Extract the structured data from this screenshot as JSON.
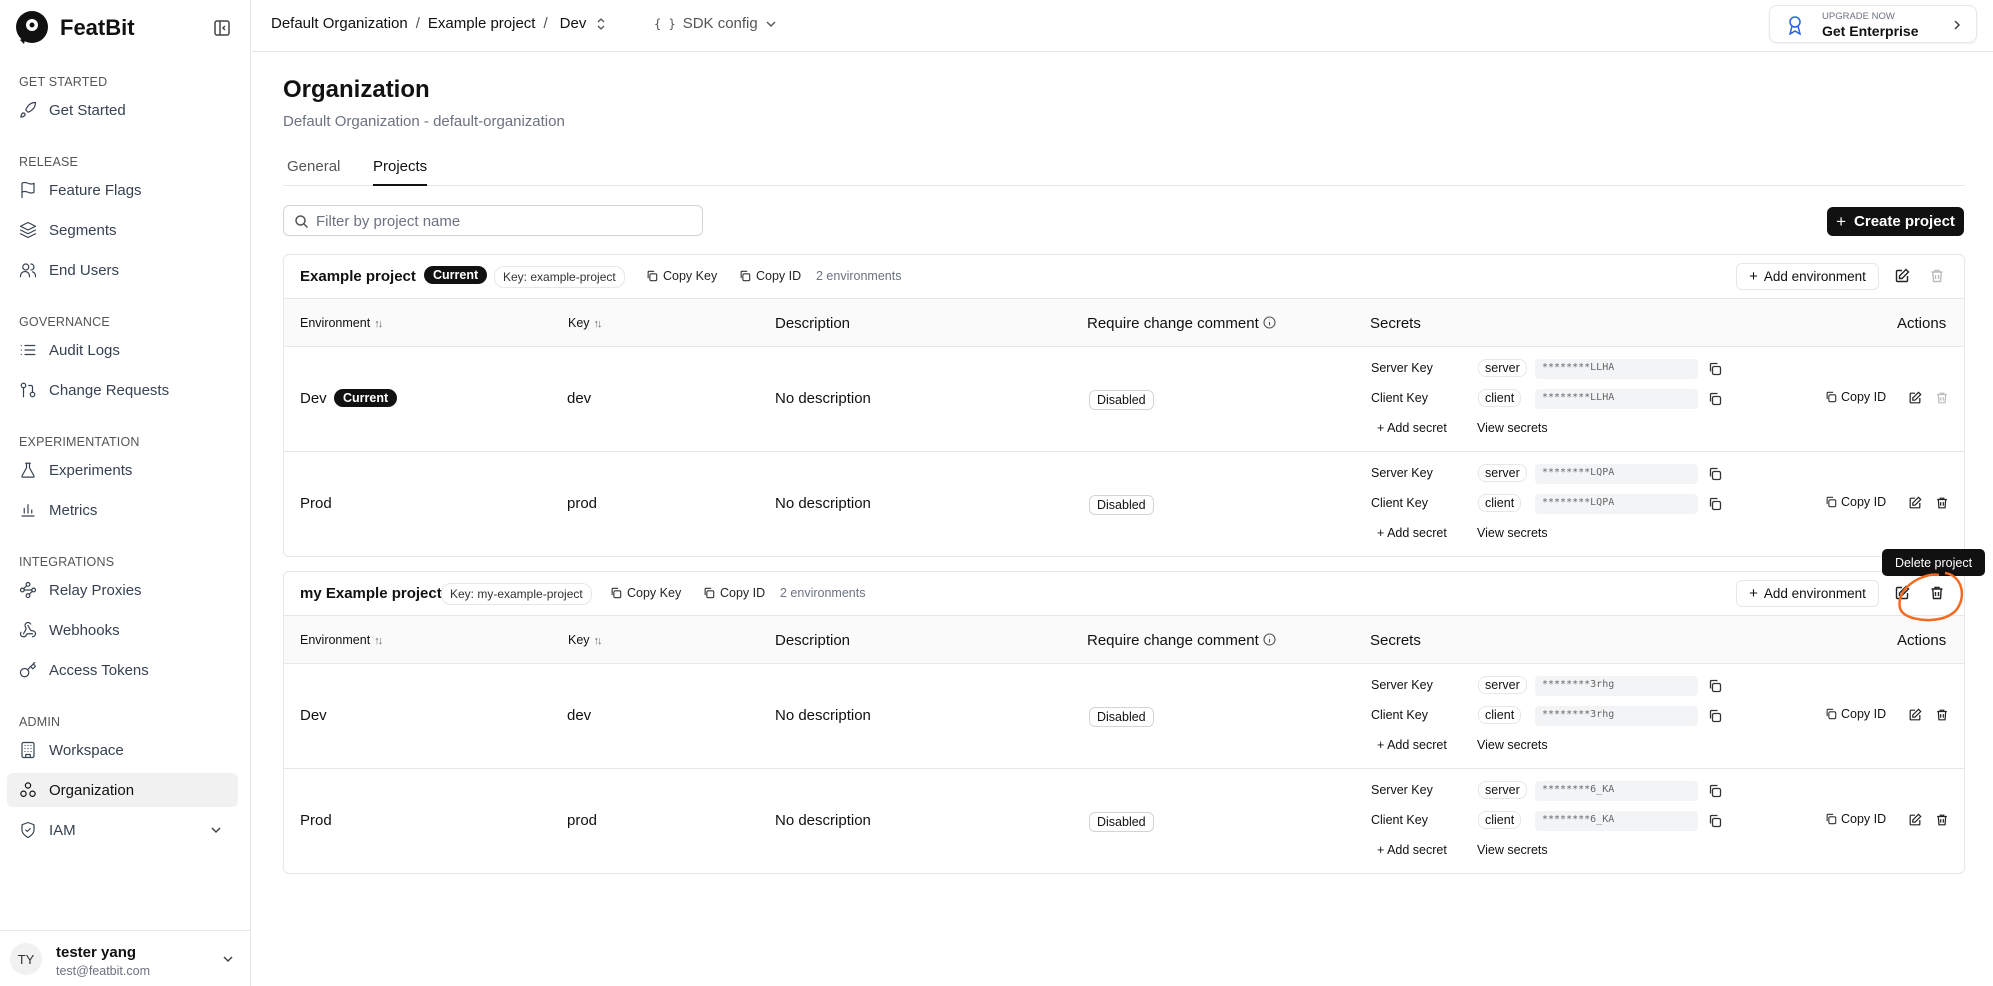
{
  "brand": {
    "name": "FeatBit"
  },
  "sidebar": {
    "sections": [
      {
        "title": "GET STARTED",
        "items": [
          {
            "label": "Get Started",
            "icon": "rocket-icon"
          }
        ]
      },
      {
        "title": "RELEASE",
        "items": [
          {
            "label": "Feature Flags",
            "icon": "flag-icon"
          },
          {
            "label": "Segments",
            "icon": "layers-icon"
          },
          {
            "label": "End Users",
            "icon": "users-icon"
          }
        ]
      },
      {
        "title": "GOVERNANCE",
        "items": [
          {
            "label": "Audit Logs",
            "icon": "list-icon"
          },
          {
            "label": "Change Requests",
            "icon": "git-pull-request-icon"
          }
        ]
      },
      {
        "title": "EXPERIMENTATION",
        "items": [
          {
            "label": "Experiments",
            "icon": "flask-icon"
          },
          {
            "label": "Metrics",
            "icon": "bar-chart-icon"
          }
        ]
      },
      {
        "title": "INTEGRATIONS",
        "items": [
          {
            "label": "Relay Proxies",
            "icon": "waypoints-icon"
          },
          {
            "label": "Webhooks",
            "icon": "webhook-icon"
          },
          {
            "label": "Access Tokens",
            "icon": "key-icon"
          }
        ]
      },
      {
        "title": "ADMIN",
        "items": [
          {
            "label": "Workspace",
            "icon": "building-icon"
          },
          {
            "label": "Organization",
            "icon": "organization-icon",
            "active": true
          },
          {
            "label": "IAM",
            "icon": "shield-icon"
          }
        ]
      }
    ]
  },
  "user": {
    "initials": "TY",
    "name": "tester yang",
    "email": "test@featbit.com"
  },
  "topbar": {
    "org": "Default Organization",
    "project": "Example project",
    "env": "Dev",
    "sdk": "SDK config",
    "sdk_brace": "{ }"
  },
  "upgrade": {
    "small": "UPGRADE NOW",
    "large": "Get Enterprise"
  },
  "page": {
    "title": "Organization",
    "subtitle": "Default Organization - default-organization",
    "tabs": [
      "General",
      "Projects"
    ],
    "active_tab": "Projects",
    "filter_placeholder": "Filter by project name",
    "create_label": "Create project"
  },
  "labels": {
    "current": "Current",
    "copy_key": "Copy Key",
    "copy_id": "Copy ID",
    "add_environment": "Add environment",
    "add_secret": "Add secret",
    "view_secrets": "View secrets",
    "server_key": "Server Key",
    "client_key": "Client Key",
    "server": "server",
    "client": "client"
  },
  "columns": {
    "environment": "Environment",
    "key": "Key",
    "description": "Description",
    "require": "Require change comment",
    "secrets": "Secrets",
    "actions": "Actions"
  },
  "projects": [
    {
      "name": "Example project",
      "current": true,
      "key_label": "Key: example-project",
      "env_count": "2 environments",
      "envs": [
        {
          "name": "Dev",
          "current": true,
          "key": "dev",
          "description": "No description",
          "require": "Disabled",
          "server_secret": "********LLHA",
          "client_secret": "********LLHA"
        },
        {
          "name": "Prod",
          "current": false,
          "key": "prod",
          "description": "No description",
          "require": "Disabled",
          "server_secret": "********LQPA",
          "client_secret": "********LQPA"
        }
      ]
    },
    {
      "name": "my Example project",
      "current": false,
      "key_label": "Key: my-example-project",
      "env_count": "2 environments",
      "envs": [
        {
          "name": "Dev",
          "current": false,
          "key": "dev",
          "description": "No description",
          "require": "Disabled",
          "server_secret": "********3rhg",
          "client_secret": "********3rhg"
        },
        {
          "name": "Prod",
          "current": false,
          "key": "prod",
          "description": "No description",
          "require": "Disabled",
          "server_secret": "********6_KA",
          "client_secret": "********6_KA"
        }
      ]
    }
  ],
  "tooltip": {
    "text": "Delete project"
  },
  "colors": {
    "accent": "#111111",
    "annotation": "#f26b21",
    "active_bg": "#f1f1f2",
    "border": "#e5e7eb"
  }
}
